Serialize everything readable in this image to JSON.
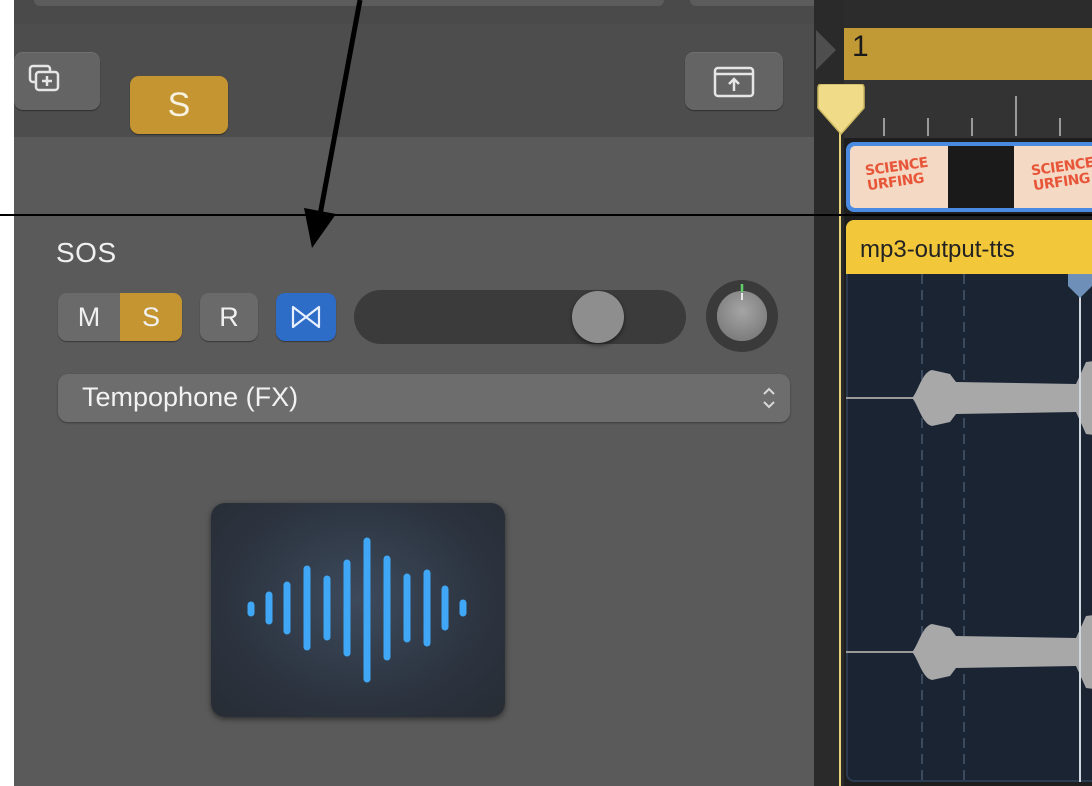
{
  "toolbar": {
    "solo_label": "S"
  },
  "track": {
    "name": "SOS",
    "mute_label": "M",
    "solo_label": "S",
    "record_label": "R",
    "plugin": "Tempophone (FX)",
    "volume_level": 0.78
  },
  "arrangement": {
    "bar_number": "1",
    "region_name": "mp3-output-tts",
    "video_text": "SCIENCE\nURFING"
  },
  "colors": {
    "solo_yellow": "#c49530",
    "flex_blue": "#2d6cc7",
    "region_yellow": "#f2c83a",
    "waveform_blue": "#3fa7f5"
  }
}
